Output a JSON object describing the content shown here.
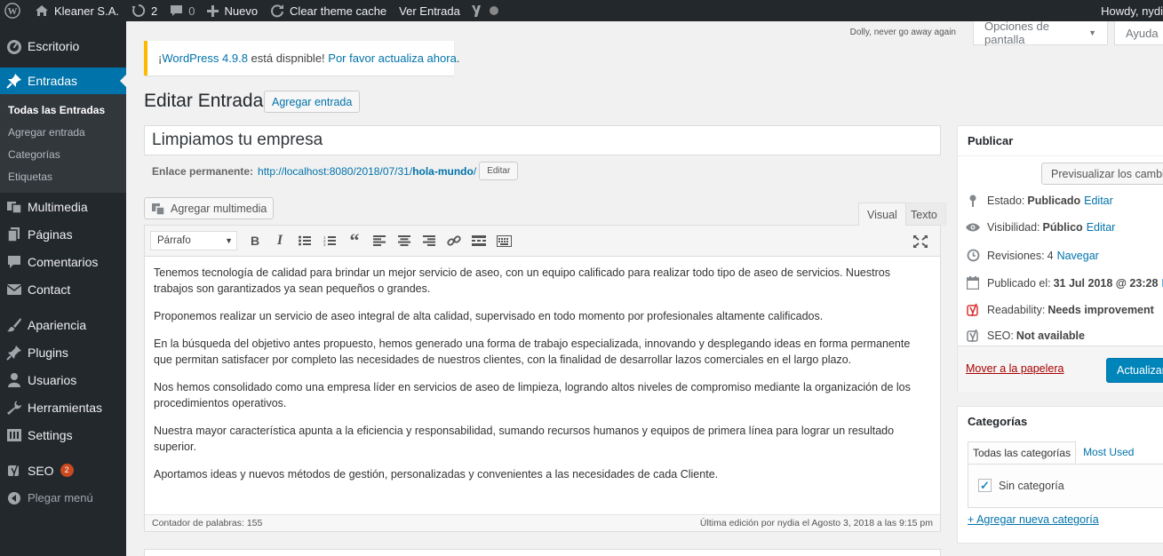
{
  "admin_bar": {
    "site_name": "Kleaner S.A.",
    "updates_count": "2",
    "comments_count": "0",
    "new_label": "Nuevo",
    "clear_cache_label": "Clear theme cache",
    "view_post_label": "Ver Entrada",
    "howdy": "Howdy, nydi"
  },
  "sidebar": {
    "items": [
      {
        "label": "Escritorio",
        "icon": "dashboard-icon"
      },
      {
        "label": "Entradas",
        "icon": "pin-icon"
      },
      {
        "label": "Multimedia",
        "icon": "media-icon"
      },
      {
        "label": "Páginas",
        "icon": "page-icon"
      },
      {
        "label": "Comentarios",
        "icon": "comment-icon"
      },
      {
        "label": "Contact",
        "icon": "mail-icon"
      },
      {
        "label": "Apariencia",
        "icon": "brush-icon"
      },
      {
        "label": "Plugins",
        "icon": "plugin-icon"
      },
      {
        "label": "Usuarios",
        "icon": "user-icon"
      },
      {
        "label": "Herramientas",
        "icon": "wrench-icon"
      },
      {
        "label": "Settings",
        "icon": "settings-icon"
      },
      {
        "label": "SEO",
        "icon": "yoast-icon",
        "badge": "2"
      }
    ],
    "submenu": [
      "Todas las Entradas",
      "Agregar entrada",
      "Categorías",
      "Etiquetas"
    ],
    "collapse_label": "Plegar menú"
  },
  "top": {
    "dolly": "Dolly, never go away again",
    "screen_options": "Opciones de pantalla",
    "help": "Ayuda"
  },
  "notice": {
    "link1": "WordPress 4.9.8",
    "text": " está dispnible! ",
    "link2": "Por favor actualiza ahora",
    "prefix": "¡",
    "suffix": "."
  },
  "page": {
    "title": "Editar Entrada",
    "add_new": "Agregar entrada"
  },
  "post": {
    "title": "Limpiamos tu empresa",
    "permalink_label": "Enlace permanente:",
    "permalink_base": "http://localhost:8080/2018/07/31/",
    "permalink_slug": "hola-mundo",
    "permalink_end": "/",
    "permalink_edit": "Editar"
  },
  "editor": {
    "add_media": "Agregar multimedia",
    "tab_visual": "Visual",
    "tab_text": "Texto",
    "format": "Párrafo",
    "paragraphs": [
      "Tenemos tecnología de calidad para brindar un mejor servicio de aseo, con un equipo calificado para realizar todo tipo de aseo de servicios. Nuestros trabajos son garantizados ya sean pequeños o grandes.",
      "Proponemos realizar un servicio de aseo integral de alta calidad, supervisado en todo momento por profesionales altamente calificados.",
      "En la búsqueda del objetivo antes propuesto, hemos generado una forma de trabajo especializada, innovando y desplegando ideas en forma permanente que permitan satisfacer por completo las necesidades de nuestros clientes, con la finalidad de desarrollar lazos comerciales en el largo plazo.",
      "Nos hemos consolidado como una empresa líder en servicios de aseo de limpieza, logrando altos niveles de compromiso mediante la organización de los procedimientos operativos.",
      "Nuestra mayor característica apunta a la eficiencia y responsabilidad, sumando recursos humanos y equipos de primera línea para lograr un resultado superior.",
      "Aportamos ideas y nuevos métodos de gestión, personalizadas y convenientes a las necesidades de cada Cliente."
    ],
    "word_count": "Contador de palabras: 155",
    "last_edit": "Última edición por nydia el Agosto 3, 2018 a las 9:15 pm"
  },
  "publish": {
    "title": "Publicar",
    "preview": "Previsualizar los cambios",
    "status_label": "Estado:",
    "status_value": "Publicado",
    "visibility_label": "Visibilidad:",
    "visibility_value": "Público",
    "revisions_label": "Revisiones:",
    "revisions_value": "4",
    "revisions_link": "Navegar",
    "published_label": "Publicado el:",
    "published_value": "31 Jul 2018 @ 23:28",
    "edit": "Editar",
    "readability_label": "Readability:",
    "readability_value": "Needs improvement",
    "seo_label": "SEO:",
    "seo_value": "Not available",
    "trash": "Mover a la papelera",
    "update": "Actualizar"
  },
  "categories": {
    "title": "Categorías",
    "tab_all": "Todas las categorías",
    "tab_used": "Most Used",
    "item": "Sin categoría",
    "item_checked": true,
    "add_new": "+ Agregar nueva categoría"
  },
  "colors": {
    "admin_bg": "#23282d",
    "accent": "#0073aa",
    "primary_button": "#0085ba",
    "notice_warning": "#ffb900",
    "badge": "#ca4a1f",
    "readability_bad": "#dc3232"
  }
}
